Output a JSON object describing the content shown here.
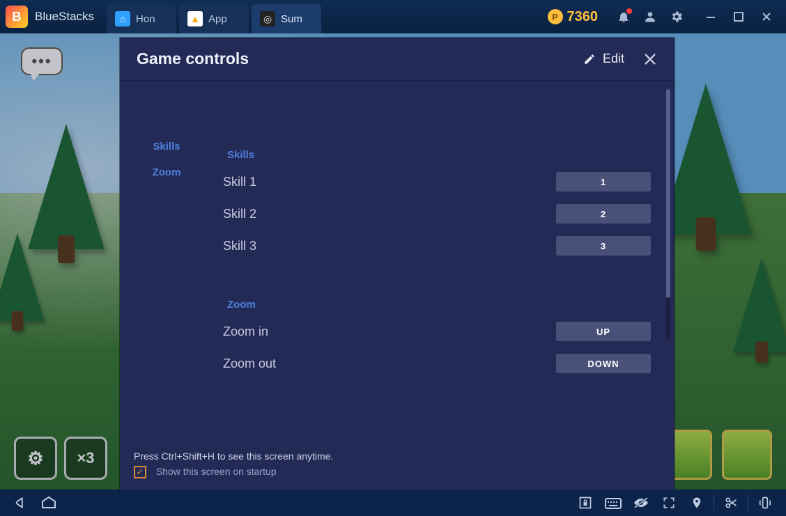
{
  "titlebar": {
    "app_name": "BlueStacks",
    "tabs": [
      {
        "label": "Hon",
        "icon": "home"
      },
      {
        "label": "App",
        "icon": "store"
      },
      {
        "label": "Sum",
        "icon": "game"
      }
    ],
    "coin_amount": "7360"
  },
  "hud": {
    "speech": "•••",
    "gear": "⚙",
    "mult": "×3"
  },
  "modal": {
    "title": "Game controls",
    "edit_label": "Edit",
    "side_nav": {
      "skills": "Skills",
      "zoom": "Zoom"
    },
    "sections": {
      "skills": {
        "heading": "Skills",
        "rows": [
          {
            "label": "Skill 1",
            "key": "1"
          },
          {
            "label": "Skill 2",
            "key": "2"
          },
          {
            "label": "Skill 3",
            "key": "3"
          }
        ]
      },
      "zoom": {
        "heading": "Zoom",
        "rows": [
          {
            "label": "Zoom in",
            "key": "UP"
          },
          {
            "label": "Zoom out",
            "key": "DOWN"
          }
        ]
      }
    },
    "footer": {
      "hint": "Press Ctrl+Shift+H to see this screen anytime.",
      "checkbox_label": "Show this screen on startup",
      "checkbox_checked": true
    }
  }
}
